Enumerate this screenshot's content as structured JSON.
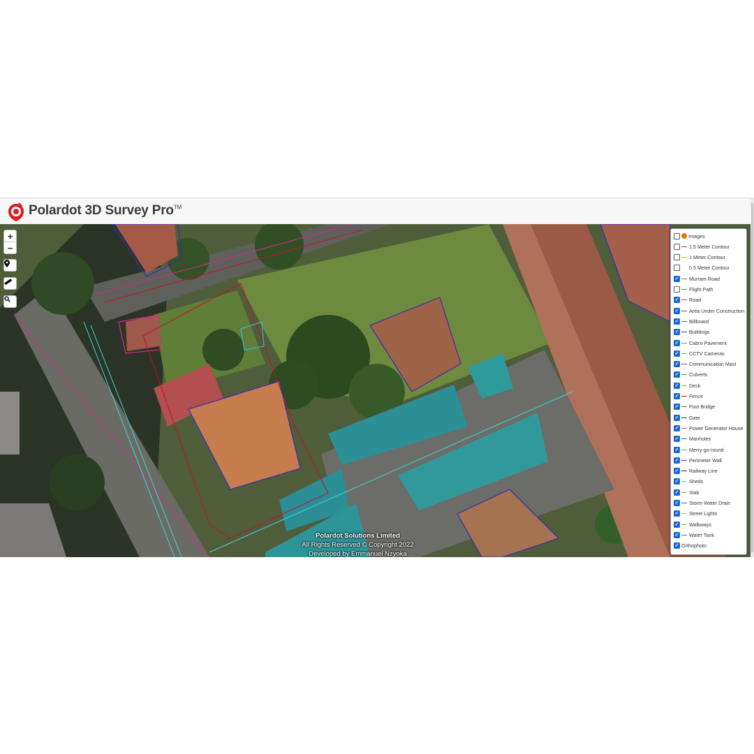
{
  "app": {
    "title": "Polardot 3D Survey Pro",
    "trademark": "TM"
  },
  "map_controls": {
    "zoom_in": "+",
    "zoom_out": "−"
  },
  "layers": [
    {
      "label": "Images",
      "checked": false,
      "marker": "dot",
      "color": "#e8740c"
    },
    {
      "label": "1.5 Meter Contour",
      "checked": false,
      "color": "#d8262f"
    },
    {
      "label": "1 Meter Contour",
      "checked": false,
      "color": "#e8a23a"
    },
    {
      "label": "0.5 Meter Contour",
      "checked": false,
      "color": "#ffffff"
    },
    {
      "label": "Murram Road",
      "checked": true,
      "color": "#b5651d"
    },
    {
      "label": "Flight Path",
      "checked": false,
      "color": "#2ab51f"
    },
    {
      "label": "Road",
      "checked": true,
      "color": "#d42a8a"
    },
    {
      "label": "Area Under Construction",
      "checked": true,
      "color": "#b22a24"
    },
    {
      "label": "Billboard",
      "checked": true,
      "color": "#555555"
    },
    {
      "label": "Buildings",
      "checked": true,
      "color": "#3b2bb5"
    },
    {
      "label": "Cabro Pavement",
      "checked": true,
      "color": "#4a8bd6"
    },
    {
      "label": "CCTV Cameras",
      "checked": true,
      "color": "#3ab3d6"
    },
    {
      "label": "Communication Mast",
      "checked": true,
      "color": "#8a2a8a"
    },
    {
      "label": "Culverts",
      "checked": true,
      "color": "#2e8a7a"
    },
    {
      "label": "Deck",
      "checked": true,
      "color": "#b5a22a"
    },
    {
      "label": "Fence",
      "checked": true,
      "color": "#c8102e"
    },
    {
      "label": "Foot Bridge",
      "checked": true,
      "color": "#7a5a2a"
    },
    {
      "label": "Gate",
      "checked": true,
      "color": "#3a3a3a"
    },
    {
      "label": "Power Generator House",
      "checked": true,
      "color": "#d45a2a"
    },
    {
      "label": "Manholes",
      "checked": true,
      "color": "#5a5ad6"
    },
    {
      "label": "Merry-go-round",
      "checked": true,
      "color": "#2ab5a2"
    },
    {
      "label": "Perimeter Wall",
      "checked": true,
      "color": "#7a2aa2"
    },
    {
      "label": "Railway Line",
      "checked": true,
      "color": "#222222"
    },
    {
      "label": "Sheds",
      "checked": true,
      "color": "#2ad6d6"
    },
    {
      "label": "Slab",
      "checked": true,
      "color": "#8a8a8a"
    },
    {
      "label": "Storm Water Drain",
      "checked": true,
      "color": "#1a5ad6"
    },
    {
      "label": "Street Lights",
      "checked": true,
      "color": "#d6c22a"
    },
    {
      "label": "Walkways",
      "checked": true,
      "color": "#d68a2a"
    },
    {
      "label": "Water Tank",
      "checked": true,
      "color": "#2a7ad6"
    },
    {
      "label": "Orthophoto",
      "checked": true,
      "marker": "none"
    }
  ],
  "credits": {
    "company": "Polardot Solutions Limited",
    "rights": "All Rights Reserved © Copyright 2022",
    "developer": "Developed by Emmanuel Nzyoka"
  }
}
